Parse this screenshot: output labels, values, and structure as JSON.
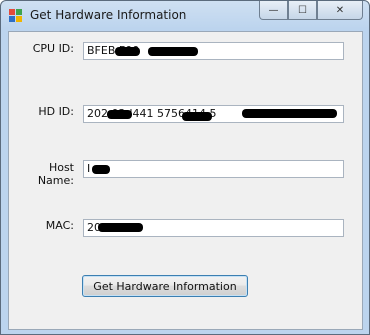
{
  "window": {
    "title": "Get Hardware Information",
    "minimize_glyph": "—",
    "maximize_glyph": "☐",
    "close_glyph": "✕"
  },
  "fields": [
    {
      "label": "CPU ID:",
      "value": "BFEB F00"
    },
    {
      "label": "HD ID:",
      "value": "202 02d441 5756414 5"
    },
    {
      "label": "Host Name:",
      "value": "I"
    },
    {
      "label": "MAC:",
      "value": "20 E7A11"
    }
  ],
  "button": {
    "label": "Get Hardware Information"
  }
}
